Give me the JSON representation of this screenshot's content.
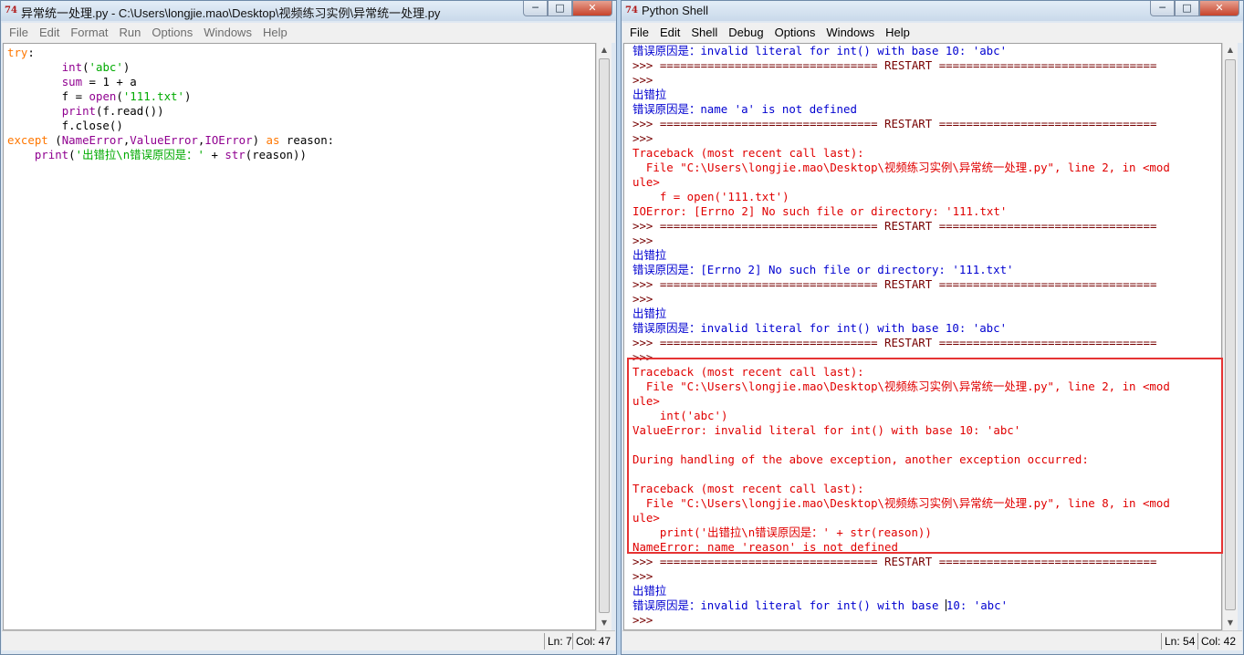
{
  "editor": {
    "title": "异常统一处理.py - C:\\Users\\longjie.mao\\Desktop\\视频练习实例\\异常统一处理.py",
    "icon_text": "74",
    "menu": [
      "File",
      "Edit",
      "Format",
      "Run",
      "Options",
      "Windows",
      "Help"
    ],
    "code_lines": [
      [
        {
          "t": "try",
          "c": "kw"
        },
        {
          "t": ":",
          "c": "plain"
        }
      ],
      [
        {
          "t": "        ",
          "c": "plain"
        },
        {
          "t": "int",
          "c": "bi"
        },
        {
          "t": "(",
          "c": "plain"
        },
        {
          "t": "'abc'",
          "c": "str"
        },
        {
          "t": ")",
          "c": "plain"
        }
      ],
      [
        {
          "t": "        ",
          "c": "plain"
        },
        {
          "t": "sum",
          "c": "bi"
        },
        {
          "t": " = 1 + a",
          "c": "plain"
        }
      ],
      [
        {
          "t": "        f = ",
          "c": "plain"
        },
        {
          "t": "open",
          "c": "bi"
        },
        {
          "t": "(",
          "c": "plain"
        },
        {
          "t": "'111.txt'",
          "c": "str"
        },
        {
          "t": ")",
          "c": "plain"
        }
      ],
      [
        {
          "t": "        ",
          "c": "plain"
        },
        {
          "t": "print",
          "c": "bi"
        },
        {
          "t": "(f.read())",
          "c": "plain"
        }
      ],
      [
        {
          "t": "        f.close()",
          "c": "plain"
        }
      ],
      [
        {
          "t": "except",
          "c": "kw"
        },
        {
          "t": " (",
          "c": "plain"
        },
        {
          "t": "NameError",
          "c": "bi"
        },
        {
          "t": ",",
          "c": "plain"
        },
        {
          "t": "ValueError",
          "c": "bi"
        },
        {
          "t": ",",
          "c": "plain"
        },
        {
          "t": "IOError",
          "c": "bi"
        },
        {
          "t": ") ",
          "c": "plain"
        },
        {
          "t": "as",
          "c": "kw"
        },
        {
          "t": " reason:",
          "c": "plain"
        }
      ],
      [
        {
          "t": "    ",
          "c": "plain"
        },
        {
          "t": "print",
          "c": "bi"
        },
        {
          "t": "(",
          "c": "plain"
        },
        {
          "t": "'出错拉\\n错误原因是：'",
          "c": "str"
        },
        {
          "t": " + ",
          "c": "plain"
        },
        {
          "t": "str",
          "c": "bi"
        },
        {
          "t": "(reason))",
          "c": "plain"
        }
      ]
    ],
    "status": {
      "ln": "Ln: 7",
      "col": "Col: 47"
    }
  },
  "shell": {
    "title": "Python Shell",
    "icon_text": "74",
    "menu": [
      "File",
      "Edit",
      "Shell",
      "Debug",
      "Options",
      "Windows",
      "Help"
    ],
    "lines": [
      [
        {
          "t": "错误原因是：",
          "c": "out"
        },
        {
          "t": "invalid literal for int() with base 10: 'abc'",
          "c": "out"
        }
      ],
      [
        {
          "t": ">>> ================================ RESTART ================================",
          "c": "prompt"
        }
      ],
      [
        {
          "t": ">>>",
          "c": "prompt"
        }
      ],
      [
        {
          "t": "出错拉",
          "c": "out"
        }
      ],
      [
        {
          "t": "错误原因是：",
          "c": "out"
        },
        {
          "t": "name 'a' is not defined",
          "c": "out"
        }
      ],
      [
        {
          "t": ">>> ================================ RESTART ================================",
          "c": "prompt"
        }
      ],
      [
        {
          "t": ">>>",
          "c": "prompt"
        }
      ],
      [
        {
          "t": "Traceback (most recent call last):",
          "c": "err"
        }
      ],
      [
        {
          "t": "  File \"C:\\Users\\longjie.mao\\Desktop\\视频练习实例\\异常统一处理.py\", line 2, in <mod",
          "c": "err"
        }
      ],
      [
        {
          "t": "ule>",
          "c": "err"
        }
      ],
      [
        {
          "t": "    f = open('111.txt')",
          "c": "err"
        }
      ],
      [
        {
          "t": "IOError: [Errno 2] No such file or directory: '111.txt'",
          "c": "err"
        }
      ],
      [
        {
          "t": ">>> ================================ RESTART ================================",
          "c": "prompt"
        }
      ],
      [
        {
          "t": ">>>",
          "c": "prompt"
        }
      ],
      [
        {
          "t": "出错拉",
          "c": "out"
        }
      ],
      [
        {
          "t": "错误原因是：",
          "c": "out"
        },
        {
          "t": "[Errno 2] No such file or directory: '111.txt'",
          "c": "out"
        }
      ],
      [
        {
          "t": ">>> ================================ RESTART ================================",
          "c": "prompt"
        }
      ],
      [
        {
          "t": ">>>",
          "c": "prompt"
        }
      ],
      [
        {
          "t": "出错拉",
          "c": "out"
        }
      ],
      [
        {
          "t": "错误原因是：",
          "c": "out"
        },
        {
          "t": "invalid literal for int() with base 10: 'abc'",
          "c": "out"
        }
      ],
      [
        {
          "t": ">>> ================================ RESTART ================================",
          "c": "prompt"
        }
      ],
      [
        {
          "t": ">>>",
          "c": "prompt"
        }
      ],
      [
        {
          "t": "Traceback (most recent call last):",
          "c": "err"
        }
      ],
      [
        {
          "t": "  File \"C:\\Users\\longjie.mao\\Desktop\\视频练习实例\\异常统一处理.py\", line 2, in <mod",
          "c": "err"
        }
      ],
      [
        {
          "t": "ule>",
          "c": "err"
        }
      ],
      [
        {
          "t": "    int('abc')",
          "c": "err"
        }
      ],
      [
        {
          "t": "ValueError: invalid literal for int() with base 10: 'abc'",
          "c": "err"
        }
      ],
      [
        {
          "t": "",
          "c": "err"
        }
      ],
      [
        {
          "t": "During handling of the above exception, another exception occurred:",
          "c": "err"
        }
      ],
      [
        {
          "t": "",
          "c": "err"
        }
      ],
      [
        {
          "t": "Traceback (most recent call last):",
          "c": "err"
        }
      ],
      [
        {
          "t": "  File \"C:\\Users\\longjie.mao\\Desktop\\视频练习实例\\异常统一处理.py\", line 8, in <mod",
          "c": "err"
        }
      ],
      [
        {
          "t": "ule>",
          "c": "err"
        }
      ],
      [
        {
          "t": "    print('出错拉\\n错误原因是：' + str(reason))",
          "c": "err"
        }
      ],
      [
        {
          "t": "NameError: name 'reason' is not defined",
          "c": "err"
        }
      ],
      [
        {
          "t": ">>> ================================ RESTART ================================",
          "c": "prompt"
        }
      ],
      [
        {
          "t": ">>>",
          "c": "prompt"
        }
      ],
      [
        {
          "t": "出错拉",
          "c": "out"
        }
      ],
      [
        {
          "t": "错误原因是：",
          "c": "out"
        },
        {
          "t": "invalid literal for int() with base ",
          "c": "out"
        },
        {
          "t": "|",
          "c": "cursor"
        },
        {
          "t": "10: 'abc'",
          "c": "out"
        }
      ],
      [
        {
          "t": ">>>",
          "c": "prompt"
        }
      ]
    ],
    "status": {
      "ln": "Ln: 54",
      "col": "Col: 42"
    }
  },
  "colors": {
    "highlight_box": "#e53333",
    "keyword": "#ff7700",
    "builtin": "#900090",
    "string": "#00aa00",
    "shell_output": "#0000d0",
    "shell_error": "#e00000"
  },
  "icons": [
    "idle-app-icon",
    "minimize-icon",
    "maximize-icon",
    "close-icon",
    "scroll-up-arrow-icon",
    "scroll-down-arrow-icon"
  ]
}
